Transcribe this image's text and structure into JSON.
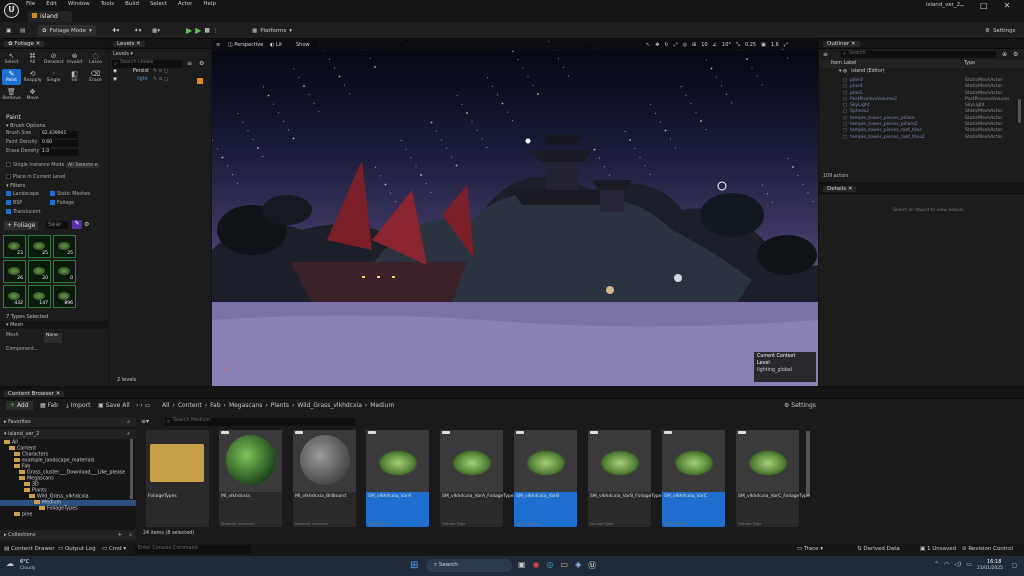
{
  "title_bar": {
    "menu": [
      "File",
      "Edit",
      "Window",
      "Tools",
      "Build",
      "Select",
      "Actor",
      "Help"
    ],
    "map_tab": "island",
    "project": "island_ver_2"
  },
  "toolbar": {
    "mode": "Foliage Mode",
    "platforms": "Platforms",
    "settings": "Settings"
  },
  "foliage_panel": {
    "tab": "Foliage",
    "modes": [
      {
        "label": "Select",
        "icon": "cursor-icon"
      },
      {
        "label": "All",
        "icon": "select-all-icon"
      },
      {
        "label": "Deselect",
        "icon": "deselect-icon"
      },
      {
        "label": "Invalid",
        "icon": "invalid-icon"
      },
      {
        "label": "Lasso",
        "icon": "lasso-icon"
      },
      {
        "label": "Paint",
        "icon": "paint-brush-icon"
      },
      {
        "label": "Reapply",
        "icon": "reapply-icon"
      },
      {
        "label": "Single",
        "icon": "single-icon"
      },
      {
        "label": "Fill",
        "icon": "fill-icon"
      },
      {
        "label": "Erase",
        "icon": "erase-icon"
      },
      {
        "label": "Remove",
        "icon": "remove-icon"
      },
      {
        "label": "Move",
        "icon": "move-icon"
      }
    ],
    "section": "Paint",
    "brush_options": "Brush Options",
    "brush_size_label": "Brush Size",
    "brush_size": "62.439941",
    "paint_density_label": "Paint Density",
    "paint_density": "0.60",
    "erase_density_label": "Erase Density",
    "erase_density": "1.0",
    "single_instance_label": "Single Instance Mode",
    "single_instance_value": "All Selecte",
    "place_in_level": "Place in Current Level",
    "filters_label": "Filters",
    "filters": [
      "Landscape",
      "Static Meshes",
      "BSP",
      "Foliage",
      "Translucent"
    ],
    "add_foliage": "+ Foliage",
    "search_placeholder": "Sear",
    "counts": [
      "23",
      "25",
      "25",
      "26",
      "20",
      "0",
      "432",
      "147",
      "896"
    ],
    "types_selected": "7 Types Selected",
    "mesh_section": "Mesh",
    "mesh_label": "Mesh",
    "mesh_value": "None",
    "component_label": "Component..."
  },
  "levels_panel": {
    "tab": "Levels",
    "levels_btn": "Levels",
    "search_placeholder": "Search Levels",
    "rows": [
      "Persist",
      "light"
    ],
    "count": "2 levels"
  },
  "viewport": {
    "perspective": "Perspective",
    "lit": "Lit",
    "show": "Show",
    "grid": "10",
    "angle": "10°",
    "scale": "0.25",
    "speed": "1.6",
    "current_context": "Current Context",
    "level_label": "Level",
    "level_value": "lighting_global"
  },
  "outliner": {
    "tab": "Outliner",
    "search_placeholder": "Search",
    "col_label": "Item Label",
    "col_type": "Type",
    "root": "island (Editor)",
    "rows": [
      {
        "name": "pine3",
        "type": "StaticMeshActor"
      },
      {
        "name": "pine4",
        "type": "StaticMeshActor"
      },
      {
        "name": "pine5",
        "type": "StaticMeshActor"
      },
      {
        "name": "PostProcessVolume2",
        "type": "PostProcessVolume"
      },
      {
        "name": "SkyLight",
        "type": "SkyLight"
      },
      {
        "name": "Sphere2",
        "type": "StaticMeshActor"
      },
      {
        "name": "temple_tower_pieces_pillars",
        "type": "StaticMeshActor"
      },
      {
        "name": "temple_tower_pieces_pillars2",
        "type": "StaticMeshActor"
      },
      {
        "name": "temple_tower_pieces_roof_tiles",
        "type": "StaticMeshActor"
      },
      {
        "name": "temple_tower_pieces_roof_tiles2",
        "type": "StaticMeshActor"
      }
    ],
    "count": "109 actors"
  },
  "details": {
    "tab": "Details",
    "empty": "Select an object to view details."
  },
  "content_browser": {
    "tab": "Content Browser",
    "add": "Add",
    "fab": "Fab",
    "import": "Import",
    "save_all": "Save All",
    "path": [
      "All",
      "Content",
      "Fab",
      "Megascans",
      "Plants",
      "Wild_Grass_vlkhdcxia",
      "Medium"
    ],
    "settings": "Settings",
    "favorites": "Favorites",
    "project_root": "island_ver_2",
    "tree": [
      {
        "label": "All",
        "depth": 0
      },
      {
        "label": "Content",
        "depth": 1
      },
      {
        "label": "Characters",
        "depth": 2
      },
      {
        "label": "example_landscape_materials",
        "depth": 2
      },
      {
        "label": "Fab",
        "depth": 2
      },
      {
        "label": "Grass_cluster___Download___Like_please",
        "depth": 3
      },
      {
        "label": "Megascans",
        "depth": 3
      },
      {
        "label": "3D",
        "depth": 4
      },
      {
        "label": "Plants",
        "depth": 4
      },
      {
        "label": "Wild_Grass_vlkhdcxia",
        "depth": 5
      },
      {
        "label": "Medium",
        "depth": 6
      },
      {
        "label": "FoliageTypes",
        "depth": 7
      },
      {
        "label": "pine",
        "depth": 2
      }
    ],
    "collections": "Collections",
    "search_placeholder": "Search Medium",
    "assets": [
      {
        "name": "FoliageTypes",
        "type": "",
        "kind": "folder"
      },
      {
        "name": "MI_vlkhdcxia",
        "type": "Material Instance",
        "kind": "sphere-green"
      },
      {
        "name": "MI_vlkhdcxia_Billboard",
        "type": "Material Instance",
        "kind": "sphere-gray"
      },
      {
        "name": "SM_vlkhdcxia_VarA",
        "type": "Static Mesh",
        "kind": "grass",
        "selected": true
      },
      {
        "name": "SM_vlkhdcxia_VarA_FoliageType",
        "type": "Foliage Type",
        "kind": "grass"
      },
      {
        "name": "SM_vlkhdcxia_VarB",
        "type": "Static Mesh",
        "kind": "grass",
        "selected": true
      },
      {
        "name": "SM_vlkhdcxia_VarB_FoliageType",
        "type": "Foliage Type",
        "kind": "grass"
      },
      {
        "name": "SM_vlkhdcxia_VarC",
        "type": "Static Mesh",
        "kind": "grass",
        "selected": true
      },
      {
        "name": "SM_vlkhdcxia_VarC_FoliageType",
        "type": "Foliage Type",
        "kind": "grass"
      }
    ],
    "item_count": "24 items (8 selected)"
  },
  "status_bar": {
    "content_drawer": "Content Drawer",
    "output_log": "Output Log",
    "cmd": "Cmd",
    "console_placeholder": "Enter Console Command",
    "trace": "Trace",
    "derived_data": "Derived Data",
    "unsaved": "1 Unsaved",
    "revision_control": "Revision Control"
  },
  "taskbar": {
    "temp": "6°C",
    "weather": "Cloudy",
    "search": "Search",
    "time": "16:18",
    "date": "21/01/2025"
  },
  "colors": {
    "accent": "#1f6fd1",
    "play": "#5cc15c"
  }
}
